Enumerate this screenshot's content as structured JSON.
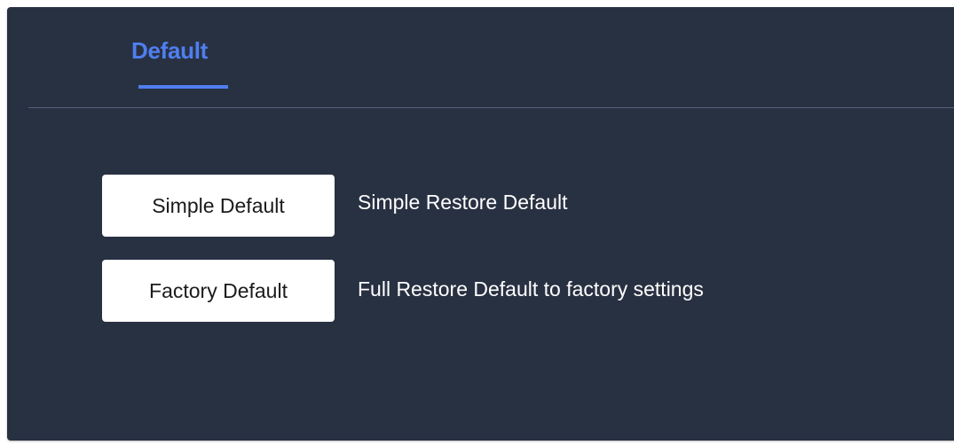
{
  "tabs": [
    {
      "label": "Default",
      "active": true
    }
  ],
  "colors": {
    "panel_background": "#283142",
    "accent": "#4f7ff0",
    "divider": "#55617a",
    "button_background": "#ffffff",
    "description_text": "#ffffff"
  },
  "actions": [
    {
      "button_label": "Simple Default",
      "description": "Simple Restore Default"
    },
    {
      "button_label": "Factory Default",
      "description": "Full Restore Default to factory settings"
    }
  ]
}
